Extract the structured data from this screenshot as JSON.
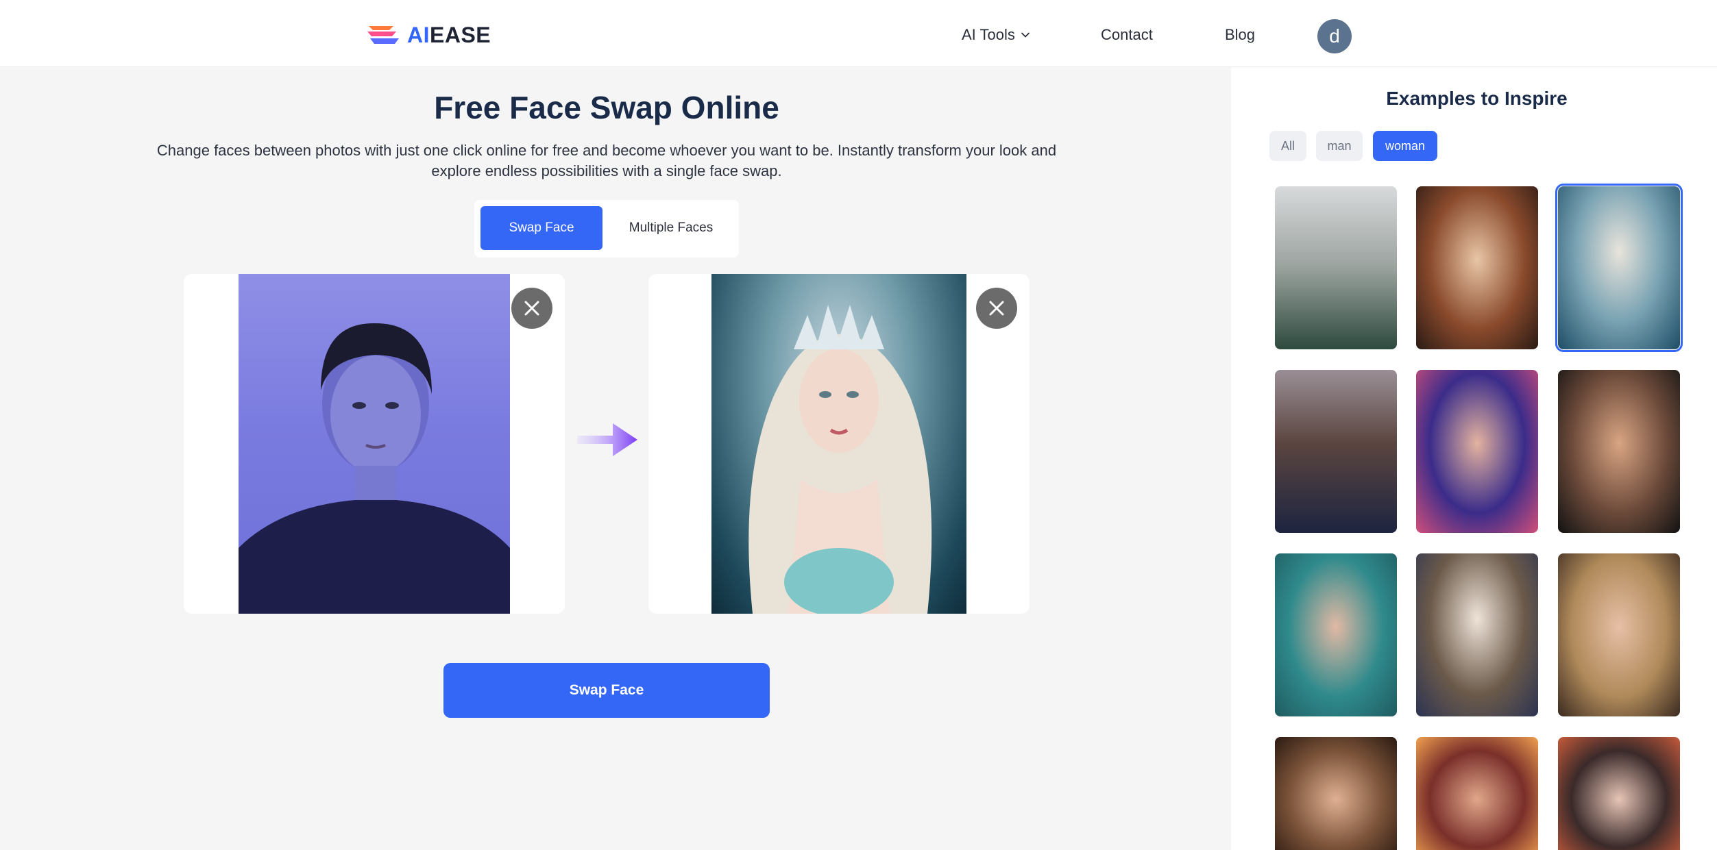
{
  "header": {
    "logo_ai": "AI",
    "logo_ease": "EASE",
    "nav": {
      "ai_tools": "AI Tools",
      "contact": "Contact",
      "blog": "Blog"
    },
    "avatar_letter": "d"
  },
  "main": {
    "title": "Free Face Swap Online",
    "subtitle": "Change faces between photos with just one click online for free and become whoever you want to be. Instantly transform your look and explore endless possibilities with a single face swap.",
    "tabs": {
      "swap_face": "Swap Face",
      "multiple_faces": "Multiple Faces"
    },
    "swap_button": "Swap Face"
  },
  "sidebar": {
    "title": "Examples to Inspire",
    "filters": {
      "all": "All",
      "man": "man",
      "woman": "woman"
    },
    "active_filter": "woman"
  },
  "colors": {
    "accent": "#3467f6",
    "title": "#1a2b4a",
    "close_button": "#6b6b6b"
  },
  "icons": {
    "logo": "aiease-logo-icon",
    "dropdown": "chevron-down-icon",
    "close": "close-icon",
    "arrow": "arrow-right-icon"
  }
}
